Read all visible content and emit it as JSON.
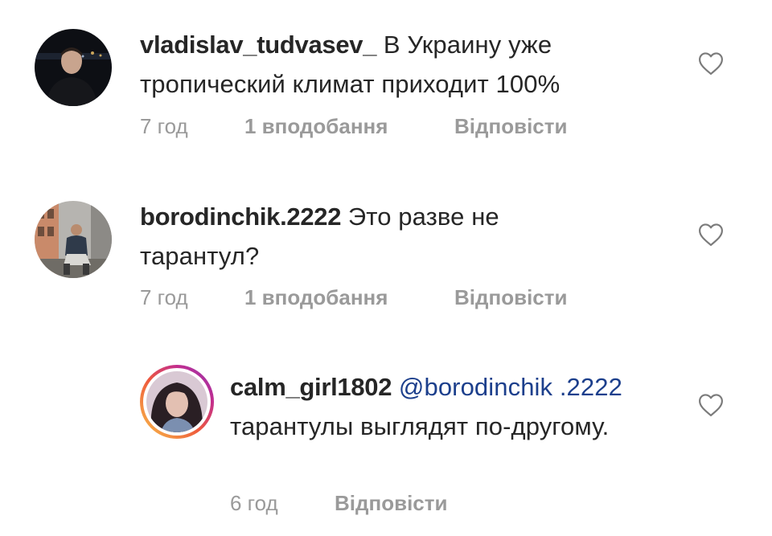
{
  "comments": [
    {
      "username": "vladislav_tudvasev_",
      "text": " В Украину уже тропический климат приходит 100%",
      "time": "7 год",
      "likes": "1 вподобання",
      "reply": "Відповісти",
      "avatar_icon": "user-avatar-photo"
    },
    {
      "username": "borodinchik.2222",
      "text": " Это разве не тарантул?",
      "time": "7 год",
      "likes": "1 вподобання",
      "reply": "Відповісти",
      "avatar_icon": "user-avatar-photo"
    },
    {
      "username": "calm_girl1802",
      "mention": " @borodinchik .2222",
      "text": "  тарантулы выглядят по-другому.",
      "time": "6 год",
      "reply": "Відповісти",
      "avatar_icon": "user-avatar-photo-story-ring"
    }
  ],
  "icons": {
    "like": "heart-outline-icon"
  },
  "colors": {
    "text": "#262626",
    "meta": "#9a9a9a",
    "mention": "#1c3f8c",
    "heart": "#7b7b7b"
  }
}
